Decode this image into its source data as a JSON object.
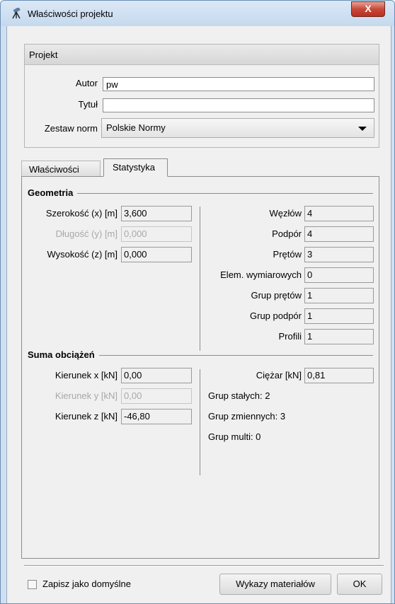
{
  "window": {
    "title": "Właściwości projektu",
    "close_label": "X"
  },
  "project": {
    "header": "Projekt",
    "author_label": "Autor",
    "author_value": "pw",
    "title_label": "Tytuł",
    "title_value": "",
    "norms_label": "Zestaw norm",
    "norms_value": "Polskie Normy"
  },
  "tabs": {
    "properties": "Właściwości",
    "statistics": "Statystyka"
  },
  "geometry": {
    "title": "Geometria",
    "width_label": "Szerokość (x) [m]",
    "width_value": "3,600",
    "length_label": "Długość (y) [m]",
    "length_value": "0,000",
    "height_label": "Wysokość (z) [m]",
    "height_value": "0,000",
    "nodes_label": "Węzłów",
    "nodes_value": "4",
    "supports_label": "Podpór",
    "supports_value": "4",
    "bars_label": "Prętów",
    "bars_value": "3",
    "dim_label": "Elem. wymiarowych",
    "dim_value": "0",
    "bargroups_label": "Grup prętów",
    "bargroups_value": "1",
    "supportgroups_label": "Grup podpór",
    "supportgroups_value": "1",
    "profiles_label": "Profili",
    "profiles_value": "1"
  },
  "loads": {
    "title": "Suma obciążeń",
    "dirx_label": "Kierunek x [kN]",
    "dirx_value": "0,00",
    "diry_label": "Kierunek y [kN]",
    "diry_value": "0,00",
    "dirz_label": "Kierunek z [kN]",
    "dirz_value": "-46,80",
    "weight_label": "Ciężar [kN]",
    "weight_value": "0,81",
    "const_groups": "Grup stałych: 2",
    "var_groups": "Grup zmiennych: 3",
    "multi_groups": "Grup multi: 0"
  },
  "footer": {
    "save_default_label": "Zapisz jako domyślne",
    "materials_button": "Wykazy materiałów",
    "ok_button": "OK"
  }
}
